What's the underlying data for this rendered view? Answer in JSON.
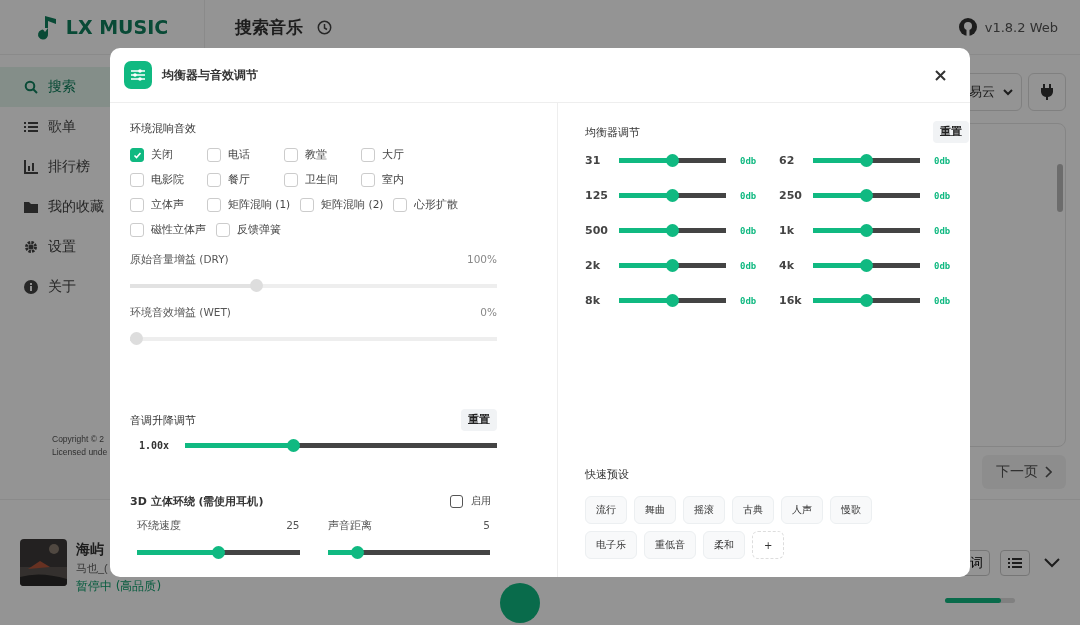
{
  "app": {
    "logo": "LX MUSIC",
    "page_title": "搜索音乐",
    "version": "v1.8.2 Web",
    "sidebar": [
      {
        "label": "搜索",
        "selected": true
      },
      {
        "label": "歌单",
        "selected": false
      },
      {
        "label": "排行榜",
        "selected": false
      },
      {
        "label": "我的收藏",
        "selected": false
      },
      {
        "label": "设置",
        "selected": false
      },
      {
        "label": "关于",
        "selected": false
      }
    ],
    "source_select": "易云",
    "footer": [
      "Copyright © 2",
      "Licensed unde"
    ],
    "next_page": "下一页",
    "player": {
      "title": "海屿",
      "artist": "马也_(",
      "status": "暂停中 (高品质)",
      "lyrics_button": "词",
      "volume": {
        "level": 0.8
      }
    }
  },
  "dialog": {
    "title": "均衡器与音效调节",
    "reverb": {
      "title": "环境混响音效",
      "options": [
        {
          "label": "关闭",
          "checked": true
        },
        {
          "label": "电话",
          "checked": false
        },
        {
          "label": "教堂",
          "checked": false
        },
        {
          "label": "大厅",
          "checked": false
        },
        {
          "label": "电影院",
          "checked": false
        },
        {
          "label": "餐厅",
          "checked": false
        },
        {
          "label": "卫生间",
          "checked": false
        },
        {
          "label": "室内",
          "checked": false
        },
        {
          "label": "立体声",
          "checked": false
        },
        {
          "label": "矩阵混响 (1)",
          "checked": false
        },
        {
          "label": "矩阵混响 (2)",
          "checked": false
        },
        {
          "label": "心形扩散",
          "checked": false
        },
        {
          "label": "磁性立体声",
          "checked": false
        },
        {
          "label": "反馈弹簧",
          "checked": false
        }
      ],
      "gains": [
        {
          "label": "原始音量增益 (DRY)",
          "value": "100%",
          "level": 0.34,
          "disabled": true
        },
        {
          "label": "环境音效增益 (WET)",
          "value": "0%",
          "level": 0,
          "disabled": true
        }
      ]
    },
    "pitch": {
      "title": "音调升降调节",
      "reset": "重置",
      "value": "1.00x",
      "level": 0.34
    },
    "surround": {
      "title": "3D 立体环绕 (需使用耳机)",
      "enable": {
        "label": "启用",
        "checked": false
      },
      "controls": [
        {
          "label": "环绕速度",
          "value": "25",
          "level": 0.5
        },
        {
          "label": "声音距离",
          "value": "5",
          "level": 0.16
        }
      ]
    },
    "equalizer": {
      "title": "均衡器调节",
      "reset": "重置",
      "bands": [
        {
          "label": "31",
          "level": 0.5,
          "value": "0db"
        },
        {
          "label": "62",
          "level": 0.5,
          "value": "0db"
        },
        {
          "label": "125",
          "level": 0.5,
          "value": "0db"
        },
        {
          "label": "250",
          "level": 0.5,
          "value": "0db"
        },
        {
          "label": "500",
          "level": 0.5,
          "value": "0db"
        },
        {
          "label": "1k",
          "level": 0.5,
          "value": "0db"
        },
        {
          "label": "2k",
          "level": 0.5,
          "value": "0db"
        },
        {
          "label": "4k",
          "level": 0.5,
          "value": "0db"
        },
        {
          "label": "8k",
          "level": 0.5,
          "value": "0db"
        },
        {
          "label": "16k",
          "level": 0.5,
          "value": "0db"
        }
      ]
    },
    "presets": {
      "title": "快速预设",
      "items": [
        "流行",
        "舞曲",
        "摇滚",
        "古典",
        "人声",
        "慢歌",
        "电子乐",
        "重低音",
        "柔和"
      ],
      "add": "+"
    }
  }
}
